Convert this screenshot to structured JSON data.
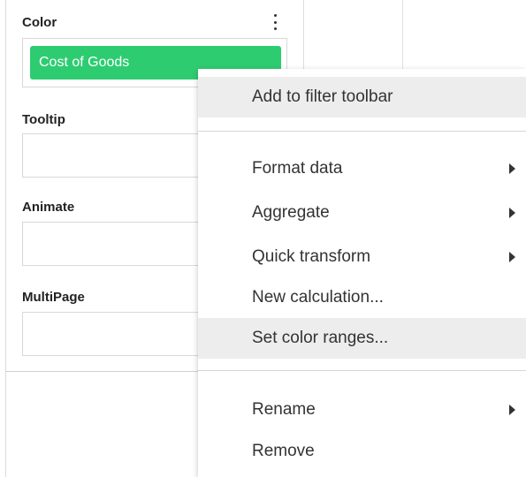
{
  "sections": {
    "color": {
      "title": "Color",
      "field": "Cost of Goods",
      "field_color": "#2ecc71"
    },
    "tooltip": {
      "title": "Tooltip"
    },
    "animate": {
      "title": "Animate"
    },
    "multipage": {
      "title": "MultiPage"
    }
  },
  "context_menu": {
    "items": [
      {
        "label": "Add to filter toolbar",
        "has_submenu": false
      },
      {
        "label": "Format data",
        "has_submenu": true
      },
      {
        "label": "Aggregate",
        "has_submenu": true
      },
      {
        "label": "Quick transform",
        "has_submenu": true
      },
      {
        "label": "New calculation...",
        "has_submenu": false
      },
      {
        "label": "Set color ranges...",
        "has_submenu": false
      },
      {
        "label": "Rename",
        "has_submenu": true
      },
      {
        "label": "Remove",
        "has_submenu": false
      }
    ]
  }
}
